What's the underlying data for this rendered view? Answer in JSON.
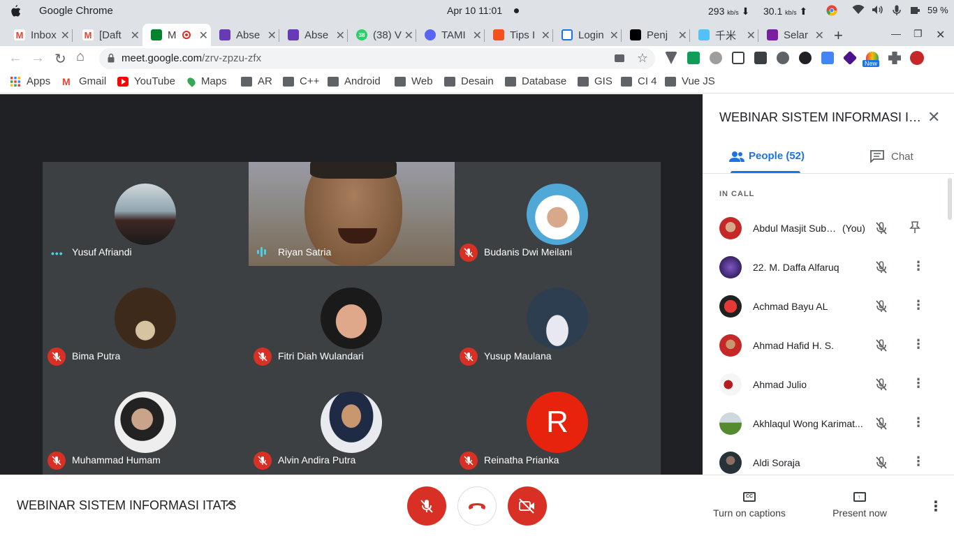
{
  "os": {
    "app_name": "Google Chrome",
    "clock": "Apr 10  11:01",
    "net_down": "293",
    "net_down_unit": "kb/s",
    "net_up": "30.1",
    "net_up_unit": "kb/s",
    "battery": "59 %"
  },
  "tabs": [
    {
      "label": "Inbox",
      "icon": "gmail-icon",
      "color": "#ea4335"
    },
    {
      "label": "[Daft",
      "icon": "gmail-icon",
      "color": "#ea4335"
    },
    {
      "label": "M",
      "icon": "meet-icon",
      "color": "#00832d",
      "active": true
    },
    {
      "label": "Abse",
      "icon": "forms-icon",
      "color": "#673ab7"
    },
    {
      "label": "Abse",
      "icon": "forms-icon",
      "color": "#673ab7"
    },
    {
      "label": "(38) V",
      "icon": "whatsapp-icon",
      "color": "#25d366"
    },
    {
      "label": "TAMI",
      "icon": "discord-icon",
      "color": "#5865f2"
    },
    {
      "label": "Tips I",
      "icon": "blog-icon",
      "color": "#f4511e"
    },
    {
      "label": "Login",
      "icon": "login-icon",
      "color": "#1a73e8"
    },
    {
      "label": "Penj",
      "icon": "medium-icon",
      "color": "#000000"
    },
    {
      "label": "千米",
      "icon": "site-icon",
      "color": "#4fc3f7"
    },
    {
      "label": "Selar",
      "icon": "yahoo-icon",
      "color": "#7b1fa2"
    }
  ],
  "address": {
    "domain": "meet.google.com",
    "path": "/zrv-zpzu-zfx"
  },
  "bookmarks": [
    {
      "label": "Apps",
      "icon": "apps-grid-icon"
    },
    {
      "label": "Gmail",
      "icon": "gmail-icon"
    },
    {
      "label": "YouTube",
      "icon": "youtube-icon"
    },
    {
      "label": "Maps",
      "icon": "maps-pin-icon"
    },
    {
      "label": "AR",
      "icon": "folder-icon"
    },
    {
      "label": "C++",
      "icon": "folder-icon"
    },
    {
      "label": "Android",
      "icon": "folder-icon"
    },
    {
      "label": "Web",
      "icon": "folder-icon"
    },
    {
      "label": "Desain",
      "icon": "folder-icon"
    },
    {
      "label": "Database",
      "icon": "folder-icon"
    },
    {
      "label": "GIS",
      "icon": "folder-icon"
    },
    {
      "label": "CI 4",
      "icon": "folder-icon"
    },
    {
      "label": "Vue JS",
      "icon": "folder-icon"
    }
  ],
  "tiles": [
    {
      "name": "Yusuf Afriandi",
      "status": "speaking-dots"
    },
    {
      "name": "Riyan Satria",
      "status": "speaking-bars",
      "video": true
    },
    {
      "name": "Budanis Dwi Meilani",
      "status": "muted"
    },
    {
      "name": "Bima Putra",
      "status": "muted"
    },
    {
      "name": "Fitri Diah Wulandari",
      "status": "muted"
    },
    {
      "name": "Yusup Maulana",
      "status": "muted"
    },
    {
      "name": "Muhammad Humam",
      "status": "muted"
    },
    {
      "name": "Alvin Andira Putra",
      "status": "muted"
    },
    {
      "name": "Reinatha Prianka",
      "status": "muted",
      "letter": "R"
    }
  ],
  "panel": {
    "title": "WEBINAR SISTEM INFORMASI ITA...",
    "tab_people": "People (52)",
    "tab_chat": "Chat",
    "section": "IN CALL",
    "you_label": "(You)",
    "people": [
      {
        "name": "Abdul Masjit Sube...",
        "you": true
      },
      {
        "name": "22. M. Daffa Alfaruq"
      },
      {
        "name": "Achmad Bayu AL"
      },
      {
        "name": "Ahmad Hafid H. S."
      },
      {
        "name": "Ahmad Julio"
      },
      {
        "name": "Akhlaqul Wong Karimat..."
      },
      {
        "name": "Aldi Soraja"
      }
    ]
  },
  "bottom": {
    "meeting_name": "WEBINAR SISTEM INFORMASI ITATS",
    "captions_label": "Turn on captions",
    "captions_icon_text": "CC",
    "present_label": "Present now"
  },
  "colors": {
    "accent": "#1a73e8",
    "danger": "#d93025",
    "speaking": "#4ecde6",
    "stage_bg": "#202124",
    "tile_bg": "#3c4043"
  }
}
